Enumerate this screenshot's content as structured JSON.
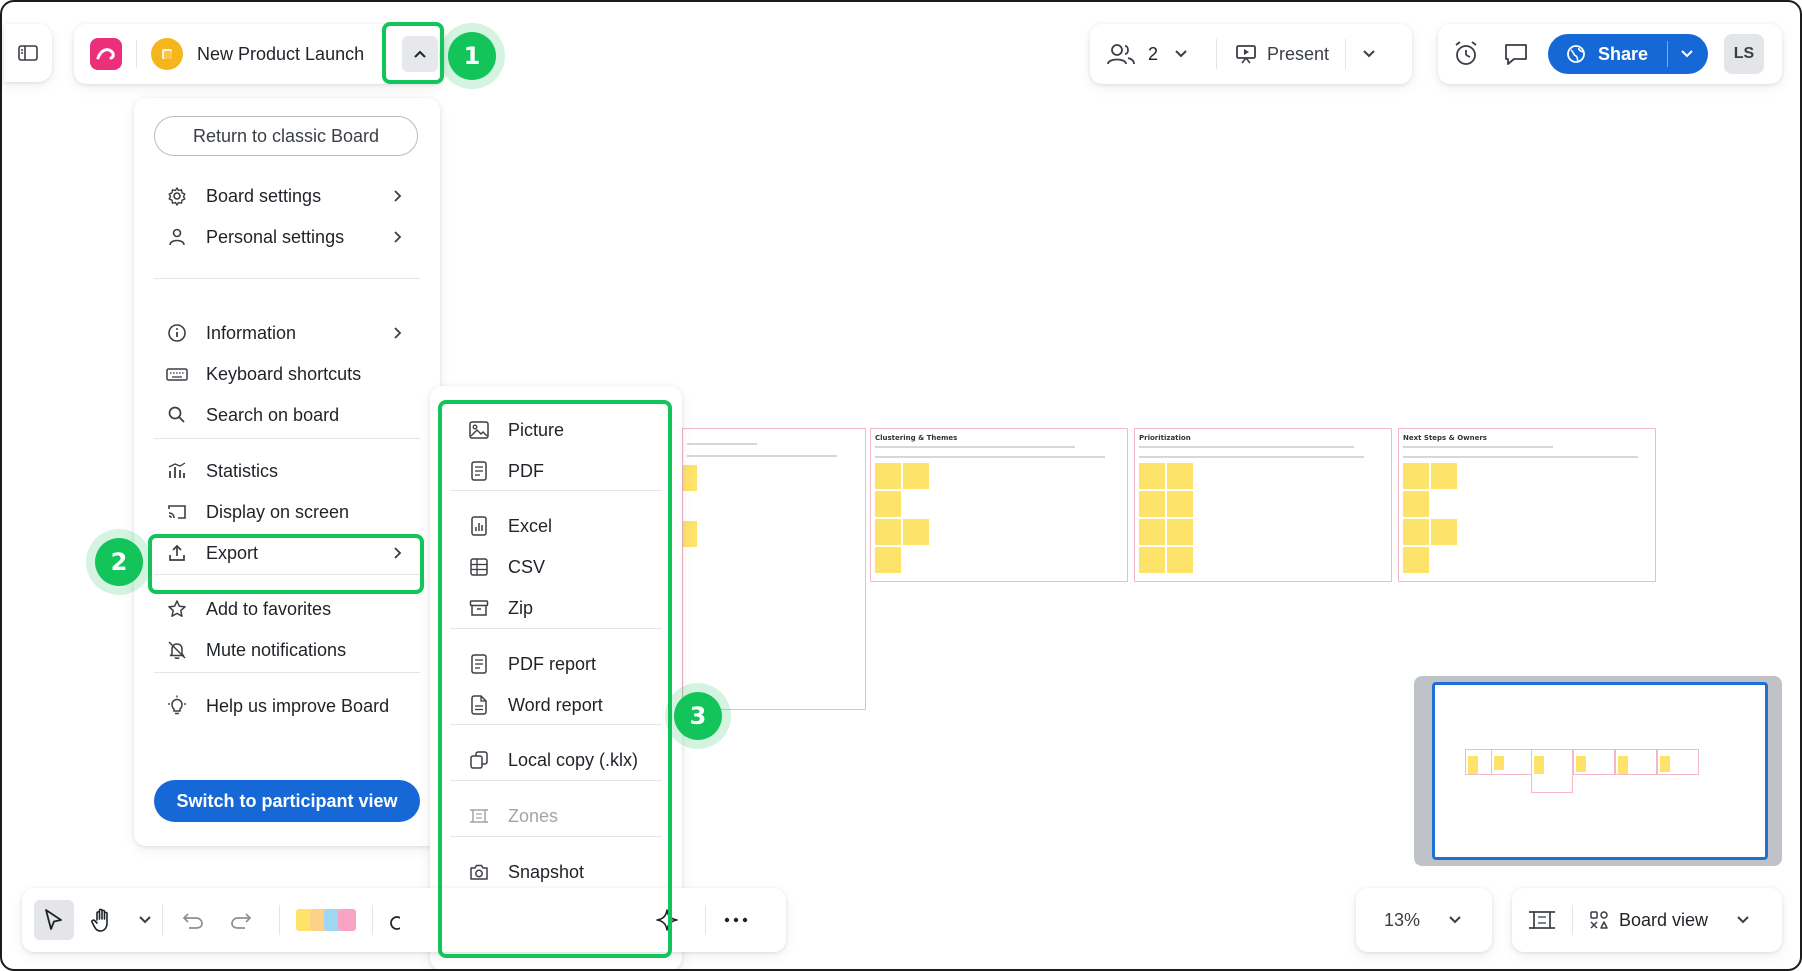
{
  "header": {
    "board_title": "New Product Launch",
    "participants_count": "2",
    "present_label": "Present",
    "share_label": "Share",
    "avatar_initials": "LS"
  },
  "menu": {
    "return_label": "Return to classic Board",
    "items": [
      {
        "label": "Board settings",
        "icon": "gear-icon"
      },
      {
        "label": "Personal settings",
        "icon": "person-icon"
      },
      {
        "label": "Information",
        "icon": "info-icon"
      },
      {
        "label": "Keyboard shortcuts",
        "icon": "keyboard-icon"
      },
      {
        "label": "Search on board",
        "icon": "search-icon"
      },
      {
        "label": "Statistics",
        "icon": "statistics-icon"
      },
      {
        "label": "Display on screen",
        "icon": "cast-icon"
      },
      {
        "label": "Export",
        "icon": "upload-icon"
      },
      {
        "label": "Add to favorites",
        "icon": "star-icon"
      },
      {
        "label": "Mute notifications",
        "icon": "bell-off-icon"
      },
      {
        "label": "Help us improve Board",
        "icon": "lightbulb-icon"
      }
    ],
    "switch_label": "Switch to participant view"
  },
  "export_menu": {
    "items": [
      {
        "label": "Picture",
        "icon": "image-icon"
      },
      {
        "label": "PDF",
        "icon": "document-icon"
      },
      {
        "label": "Excel",
        "icon": "excel-icon"
      },
      {
        "label": "CSV",
        "icon": "table-icon"
      },
      {
        "label": "Zip",
        "icon": "archive-icon"
      },
      {
        "label": "PDF report",
        "icon": "document-icon"
      },
      {
        "label": "Word report",
        "icon": "word-document-icon"
      },
      {
        "label": "Local copy (.klx)",
        "icon": "copy-icon"
      },
      {
        "label": "Zones",
        "icon": "zones-icon",
        "disabled": true
      },
      {
        "label": "Snapshot",
        "icon": "camera-icon"
      }
    ]
  },
  "annotations": {
    "step1": "1",
    "step2": "2",
    "step3": "3",
    "highlight_color": "#12c45a"
  },
  "canvas": {
    "frames": [
      {
        "title": "Clustering & Themes"
      },
      {
        "title": "Prioritization"
      },
      {
        "title": "Next Steps & Owners"
      }
    ]
  },
  "bottom": {
    "zoom": "13%",
    "view_label": "Board view"
  },
  "colors": {
    "accent": "#1568d6",
    "logo": "#ec2f7a",
    "board_badge": "#f5b51d",
    "sticky": "#fde36a"
  }
}
